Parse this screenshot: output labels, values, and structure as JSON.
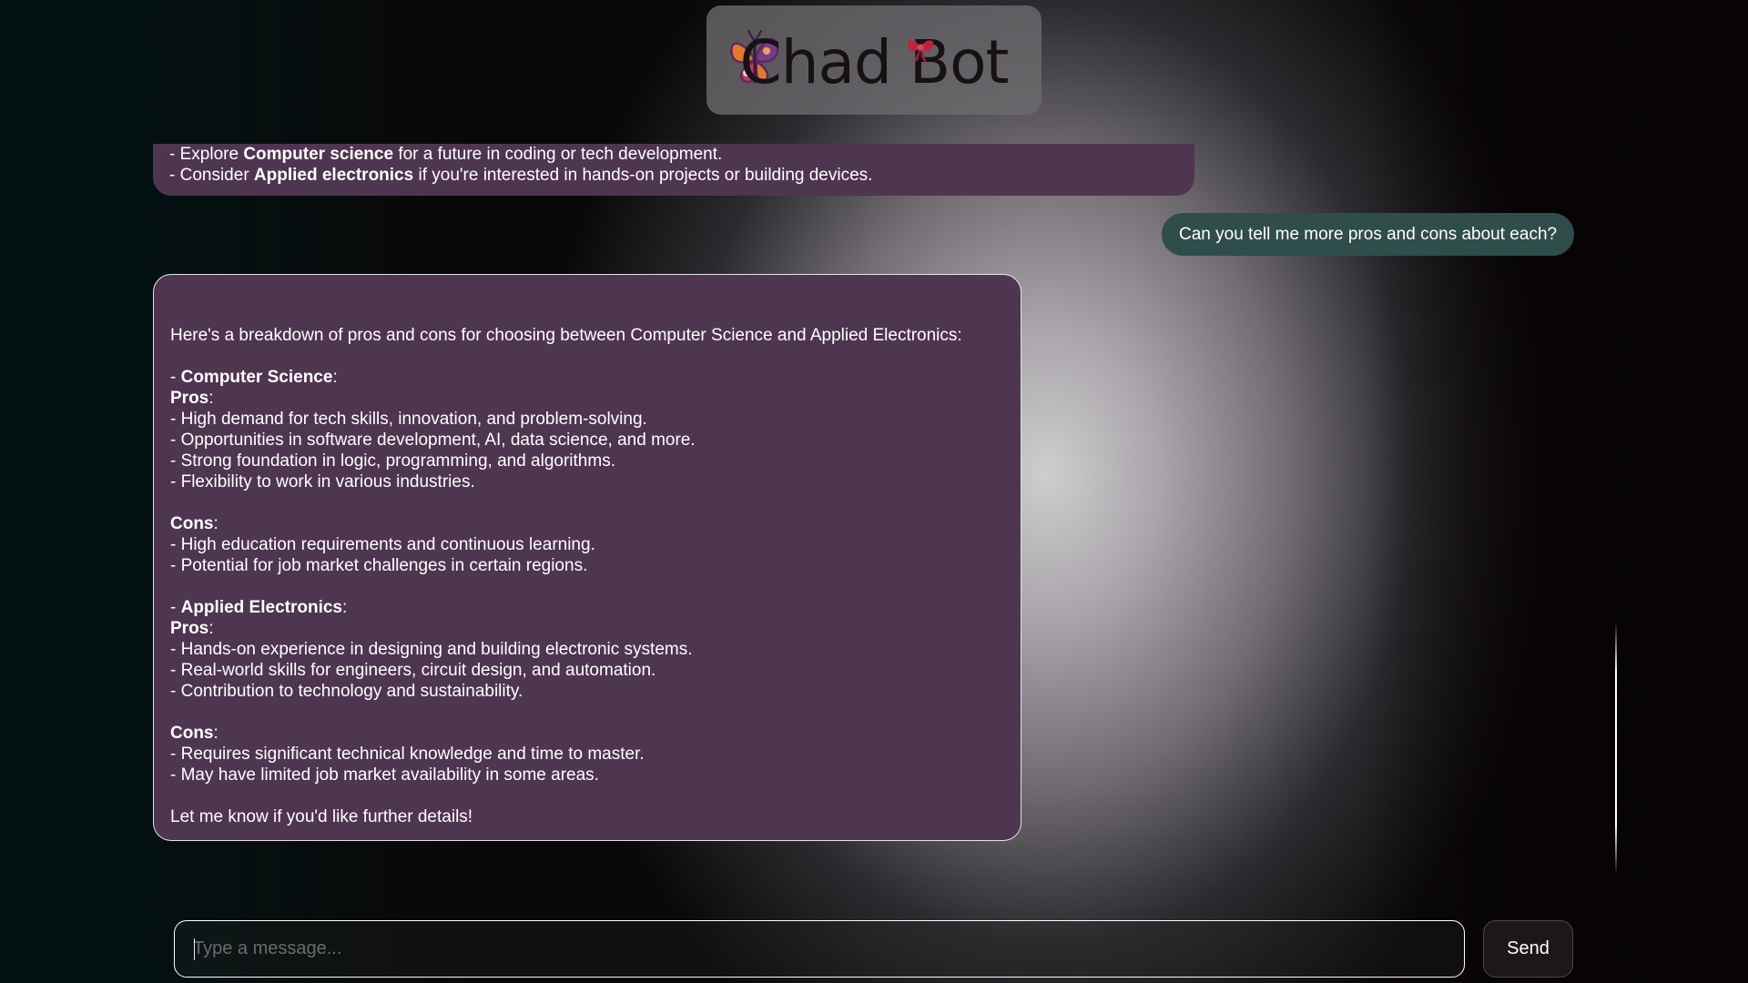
{
  "app": {
    "title": "Chad Bot"
  },
  "messages": {
    "previous_bot": {
      "line1": {
        "prefix": "- Explore ",
        "bold": "Computer science",
        "suffix": " for a future in coding or tech development."
      },
      "line2": {
        "prefix": "- Consider ",
        "bold": "Applied electronics",
        "suffix": " if you're interested in hands-on projects or building devices."
      }
    },
    "user": "Can you tell me more pros and cons about each?",
    "bot": {
      "intro": "Here's a breakdown of pros and cons for choosing between Computer Science and Applied Electronics:",
      "cs_heading": "Computer Science",
      "cs_pros_label": "Pros",
      "cs_pros": [
        "- High demand for tech skills, innovation, and problem-solving.",
        "- Opportunities in software development, AI, data science, and more.",
        "- Strong foundation in logic, programming, and algorithms.",
        "- Flexibility to work in various industries."
      ],
      "cs_cons_label": "Cons",
      "cs_cons": [
        "- High education requirements and continuous learning.",
        "- Potential for job market challenges in certain regions."
      ],
      "ae_heading": "Applied Electronics",
      "ae_pros_label": "Pros",
      "ae_pros": [
        "- Hands-on experience in designing and building electronic systems.",
        "- Real-world skills for engineers, circuit design, and automation.",
        "- Contribution to technology and sustainability."
      ],
      "ae_cons_label": "Cons",
      "ae_cons": [
        "- Requires significant technical knowledge and time to master.",
        "- May have limited job market availability in some areas."
      ],
      "closing": "Let me know if you'd like further details!"
    }
  },
  "composer": {
    "placeholder": "Type a message...",
    "value": "",
    "send_label": "Send"
  },
  "colors": {
    "bot_bubble": "#4e3550",
    "user_bubble": "#2f4d4a",
    "logo_card": "#6e6c70"
  },
  "icons": {
    "logo_left": "butterfly-icon",
    "logo_right": "bow-icon"
  }
}
